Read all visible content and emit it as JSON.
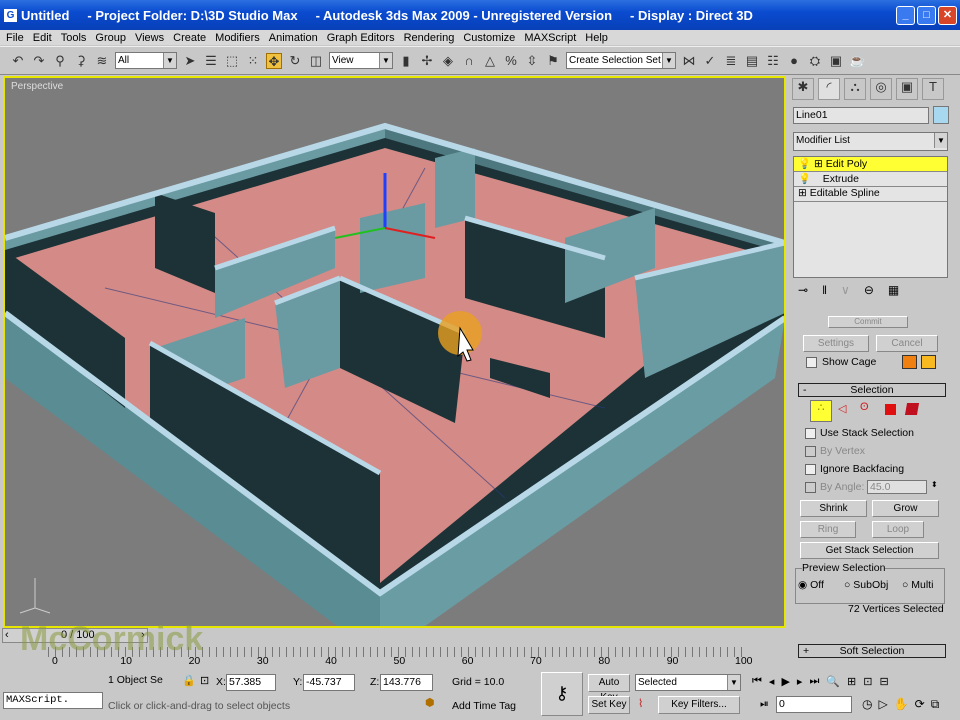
{
  "title": {
    "doc": "Untitled",
    "folder": "- Project Folder: D:\\3D Studio Max",
    "app": "- Autodesk 3ds Max  2009  - Unregistered Version",
    "display": "- Display : Direct 3D"
  },
  "menu": [
    "File",
    "Edit",
    "Tools",
    "Group",
    "Views",
    "Create",
    "Modifiers",
    "Animation",
    "Graph Editors",
    "Rendering",
    "Customize",
    "MAXScript",
    "Help"
  ],
  "toolbar": {
    "filter": "All",
    "coord": "View",
    "selection_set": "Create Selection Set"
  },
  "viewport": {
    "label": "Perspective"
  },
  "panel": {
    "object_name": "Line01",
    "object_color": "#a8d8f0",
    "modifier_list": "Modifier List",
    "stack": [
      {
        "label": "Edit Poly",
        "selected": true
      },
      {
        "label": "Extrude",
        "selected": false
      },
      {
        "label": "Editable Spline",
        "selected": false
      }
    ],
    "settings": "Settings",
    "cancel": "Cancel",
    "commit": "Commit",
    "show_cage": "Show Cage",
    "selection_title": "Selection",
    "use_stack": "Use Stack Selection",
    "by_vertex": "By Vertex",
    "ignore_backfacing": "Ignore Backfacing",
    "by_angle": "By Angle:",
    "angle_value": "45.0",
    "shrink": "Shrink",
    "grow": "Grow",
    "ring": "Ring",
    "loop": "Loop",
    "get_stack": "Get Stack Selection",
    "preview_title": "Preview Selection",
    "preview_options": [
      "Off",
      "SubObj",
      "Multi"
    ],
    "preview_selected": "Off",
    "selected_count": "72 Vertices Selected",
    "soft_selection": "Soft Selection"
  },
  "timeline": {
    "frame": "0 / 100",
    "ticks": [
      "0",
      "10",
      "20",
      "30",
      "40",
      "50",
      "60",
      "70",
      "80",
      "90",
      "100"
    ]
  },
  "status": {
    "objects": "1 Object Se",
    "x": "57.385",
    "y": "-45.737",
    "z": "143.776",
    "grid": "Grid = 10.0",
    "auto_key": "Auto Key",
    "set_key": "Set Key",
    "key_mode": "Selected",
    "key_filters": "Key Filters...",
    "add_time_tag": "Add Time Tag",
    "prompt": "Click or click-and-drag to select objects",
    "maxscript": "MAXScript.",
    "frame_field": "0",
    "x_label": "X:",
    "y_label": "Y:",
    "z_label": "Z:"
  },
  "watermark": "McCormick"
}
